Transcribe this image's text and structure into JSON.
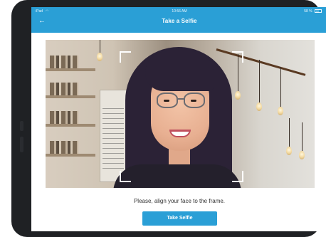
{
  "status_bar": {
    "carrier": "iPad",
    "time": "10:56 AM",
    "battery": "58 %"
  },
  "app_bar": {
    "title": "Take a Selfie"
  },
  "camera": {
    "frame_corner_color": "#ffffff"
  },
  "instruction": "Please, align your face to the frame.",
  "primary_button": {
    "label": "Take Selfie"
  },
  "colors": {
    "accent": "#2a9fd6"
  }
}
